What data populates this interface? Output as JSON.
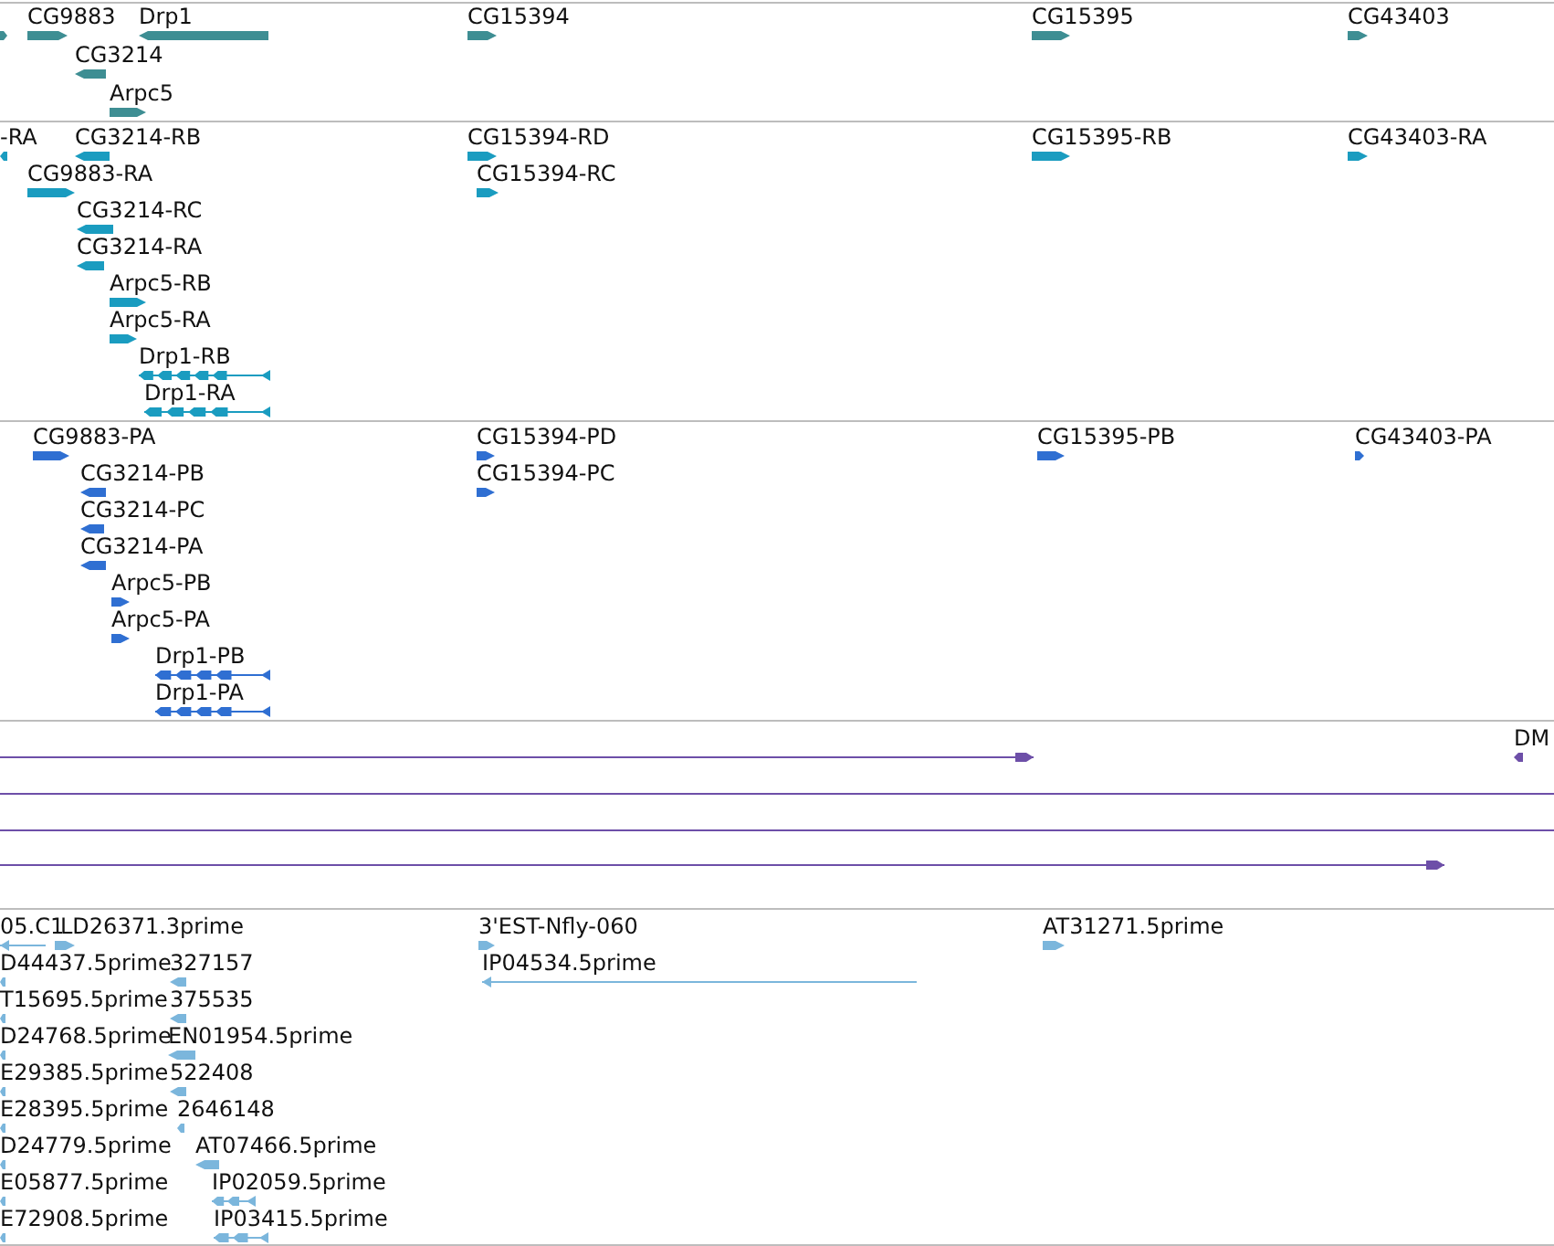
{
  "tracks": [
    {
      "color": "#3e8e93",
      "features": [
        {
          "kind": "bar",
          "reverse": false
        },
        {
          "label": "CG9883",
          "kind": "bar",
          "reverse": false
        },
        {
          "label": "Drp1",
          "kind": "bar",
          "reverse": true
        },
        {
          "label": "CG3214",
          "kind": "bar",
          "reverse": true
        },
        {
          "label": "Arpc5",
          "kind": "bar",
          "reverse": false
        },
        {
          "label": "CG15394",
          "kind": "bar",
          "reverse": false
        },
        {
          "label": "CG15395",
          "kind": "bar",
          "reverse": false
        },
        {
          "label": "CG43403",
          "kind": "bar",
          "reverse": false
        }
      ]
    },
    {
      "color": "#1a9cc0",
      "features": [
        {
          "label": "-RA",
          "kind": "bar",
          "reverse": true
        },
        {
          "label": "CG3214-RB",
          "kind": "bar",
          "reverse": true
        },
        {
          "label": "CG15394-RD",
          "kind": "bar",
          "reverse": false
        },
        {
          "label": "CG15395-RB",
          "kind": "bar",
          "reverse": false
        },
        {
          "label": "CG43403-RA",
          "kind": "bar",
          "reverse": false
        },
        {
          "label": "CG9883-RA",
          "kind": "bar",
          "reverse": false
        },
        {
          "label": "CG15394-RC",
          "kind": "bar",
          "reverse": false
        },
        {
          "label": "CG3214-RC",
          "kind": "bar",
          "reverse": true
        },
        {
          "label": "CG3214-RA",
          "kind": "bar",
          "reverse": true
        },
        {
          "label": "Arpc5-RB",
          "kind": "bar",
          "reverse": false
        },
        {
          "label": "Arpc5-RA",
          "kind": "bar",
          "reverse": false
        },
        {
          "label": "Drp1-RB",
          "kind": "spliced",
          "reverse": true
        },
        {
          "label": "Drp1-RA",
          "kind": "spliced",
          "reverse": true
        }
      ]
    },
    {
      "color": "#2f6fd2",
      "features": [
        {
          "label": "CG9883-PA",
          "kind": "bar",
          "reverse": false
        },
        {
          "label": "CG15394-PD",
          "kind": "bar",
          "reverse": false
        },
        {
          "label": "CG15395-PB",
          "kind": "bar",
          "reverse": false
        },
        {
          "label": "CG43403-PA",
          "kind": "bar",
          "reverse": false
        },
        {
          "label": "CG3214-PB",
          "kind": "bar",
          "reverse": true
        },
        {
          "label": "CG15394-PC",
          "kind": "bar",
          "reverse": false
        },
        {
          "label": "CG3214-PC",
          "kind": "bar",
          "reverse": true
        },
        {
          "label": "CG3214-PA",
          "kind": "bar",
          "reverse": true
        },
        {
          "label": "Arpc5-PB",
          "kind": "bar",
          "reverse": false
        },
        {
          "label": "Arpc5-PA",
          "kind": "bar",
          "reverse": false
        },
        {
          "label": "Drp1-PB",
          "kind": "spliced",
          "reverse": true
        },
        {
          "label": "Drp1-PA",
          "kind": "spliced",
          "reverse": true
        }
      ]
    },
    {
      "color": "#6d4fa8",
      "features": [
        {
          "kind": "line",
          "reverse": false
        },
        {
          "label": "DM",
          "kind": "bar",
          "reverse": true
        },
        {
          "kind": "line"
        },
        {
          "kind": "line"
        },
        {
          "kind": "line",
          "reverse": false
        }
      ]
    },
    {
      "color": "#7bb6dc",
      "features": [
        {
          "label": "05.C1",
          "kind": "line",
          "reverse": true
        },
        {
          "label": "LD26371.3prime",
          "kind": "bar",
          "reverse": false
        },
        {
          "label": "3'EST-Nfly-060",
          "kind": "bar",
          "reverse": false
        },
        {
          "label": "AT31271.5prime",
          "kind": "bar",
          "reverse": false
        },
        {
          "label": "D44437.5prime",
          "kind": "bar",
          "reverse": true
        },
        {
          "label": "327157",
          "kind": "bar",
          "reverse": true
        },
        {
          "label": "IP04534.5prime",
          "kind": "line",
          "reverse": true
        },
        {
          "label": "T15695.5prime",
          "kind": "bar",
          "reverse": true
        },
        {
          "label": "375535",
          "kind": "bar",
          "reverse": true
        },
        {
          "label": "D24768.5prime",
          "kind": "bar",
          "reverse": true
        },
        {
          "label": "EN01954.5prime",
          "kind": "bar",
          "reverse": true
        },
        {
          "label": "E29385.5prime",
          "kind": "bar",
          "reverse": true
        },
        {
          "label": "522408",
          "kind": "bar",
          "reverse": true
        },
        {
          "label": "E28395.5prime",
          "kind": "bar",
          "reverse": true
        },
        {
          "label": "2646148",
          "kind": "bar",
          "reverse": true
        },
        {
          "label": "D24779.5prime",
          "kind": "bar",
          "reverse": true
        },
        {
          "label": "AT07466.5prime",
          "kind": "bar",
          "reverse": true
        },
        {
          "label": "E05877.5prime",
          "kind": "bar",
          "reverse": true
        },
        {
          "label": "IP02059.5prime",
          "kind": "spliced",
          "reverse": true
        },
        {
          "label": "E72908.5prime",
          "kind": "bar",
          "reverse": true
        },
        {
          "label": "IP03415.5prime",
          "kind": "spliced",
          "reverse": true
        }
      ]
    }
  ]
}
